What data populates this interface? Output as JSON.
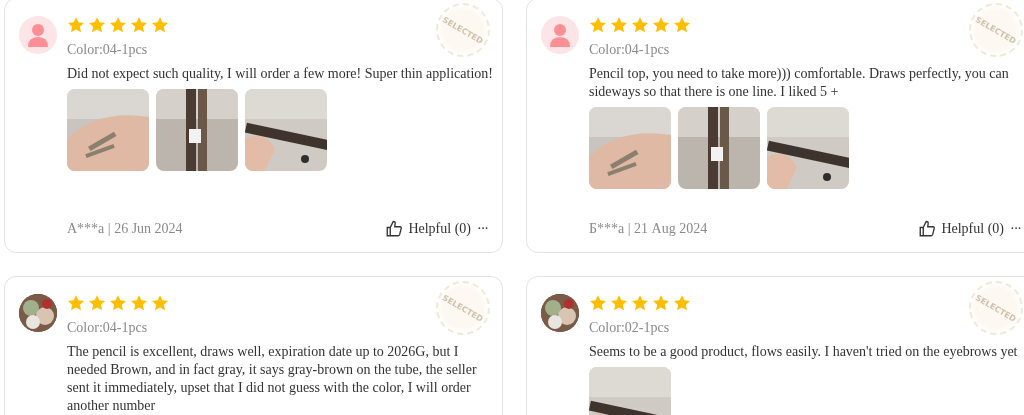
{
  "reviews": [
    {
      "avatar": {
        "kind": "default"
      },
      "stars": 5,
      "variant": "Color:04-1pcs",
      "badge": "SELECTED",
      "text": "Did not expect such quality, I will order a few more! Super thin application!",
      "images": [
        {
          "kind": "picture"
        },
        {
          "kind": "picture"
        },
        {
          "kind": "picture"
        }
      ],
      "author_date": "A***a | 26 Jun 2024",
      "helpful": "Helpful (0)",
      "more": "···"
    },
    {
      "avatar": {
        "kind": "default"
      },
      "stars": 5,
      "variant": "Color:04-1pcs",
      "badge": "SELECTED",
      "text": "Pencil top, you need to take more))) comfortable. Draws perfectly, you can sideways so that there is one line. I liked 5 +",
      "images": [
        {
          "kind": "picture"
        },
        {
          "kind": "picture"
        },
        {
          "kind": "picture"
        }
      ],
      "author_date": "Б***а | 21 Aug 2024",
      "helpful": "Helpful (0)",
      "more": "···"
    },
    {
      "avatar": {
        "kind": "picture"
      },
      "stars": 5,
      "variant": "Color:04-1pcs",
      "badge": "SELECTED",
      "text": "The pencil is excellent, draws well, expiration date up to 2026G, but I needed Brown, and in fact gray, it says gray-brown on the tube, the seller sent it immediately, upset that I did not guess with the color, I will order another number"
    },
    {
      "avatar": {
        "kind": "picture"
      },
      "stars": 5,
      "variant": "Color:02-1pcs",
      "badge": "SELECTED",
      "text": "Seems to be a good product, flows easily. I haven't tried on the eyebrows yet",
      "images": [
        {
          "kind": "picture"
        }
      ]
    }
  ]
}
